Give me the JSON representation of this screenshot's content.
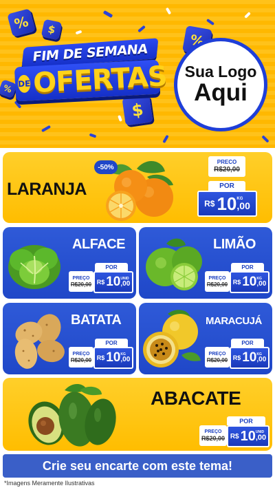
{
  "header": {
    "title_top": "FIM DE SEMANA",
    "title_de": "DE",
    "title_main": "OFERTAS",
    "logo_line1": "Sua Logo",
    "logo_line2": "Aqui",
    "cube_symbols": [
      "%",
      "$",
      "%",
      "$",
      "%"
    ]
  },
  "products": [
    {
      "name": "LARANJA",
      "discount_badge": "-50%",
      "preco_label": "PRECO",
      "old_price": "R$20,00",
      "por_label": "POR",
      "currency": "R$",
      "price_int": "10",
      "price_dec": ",00",
      "unit": "KG"
    },
    {
      "name": "ALFACE",
      "preco_label": "PREÇO",
      "old_price": "R$20,00",
      "por_label": "POR",
      "currency": "R$",
      "price_int": "10",
      "price_dec": ",00",
      "unit": "UNID"
    },
    {
      "name": "LIMÃO",
      "preco_label": "PREÇO",
      "old_price": "R$20,00",
      "por_label": "POR",
      "currency": "R$",
      "price_int": "10",
      "price_dec": ",00",
      "unit": "KG"
    },
    {
      "name": "BATATA",
      "preco_label": "PREÇO",
      "old_price": "R$20,00",
      "por_label": "POR",
      "currency": "R$",
      "price_int": "10",
      "price_dec": ",00",
      "unit": "KG"
    },
    {
      "name": "MARACUJÁ",
      "preco_label": "PREÇO",
      "old_price": "R$20,00",
      "por_label": "POR",
      "currency": "R$",
      "price_int": "10",
      "price_dec": ",00",
      "unit": "KG"
    },
    {
      "name": "ABACATE",
      "preco_label": "PREÇO",
      "old_price": "R$20,00",
      "por_label": "POR",
      "currency": "R$",
      "price_int": "10",
      "price_dec": ",00",
      "unit": "UNID"
    }
  ],
  "footer": {
    "banner": "Crie seu encarte com este tema!",
    "disclaimer": "*Imagens Meramente Ilustrativas"
  },
  "colors": {
    "yellow": "#ffc21a",
    "blue": "#1f47c8",
    "banner_blue": "#3a5fc8"
  }
}
